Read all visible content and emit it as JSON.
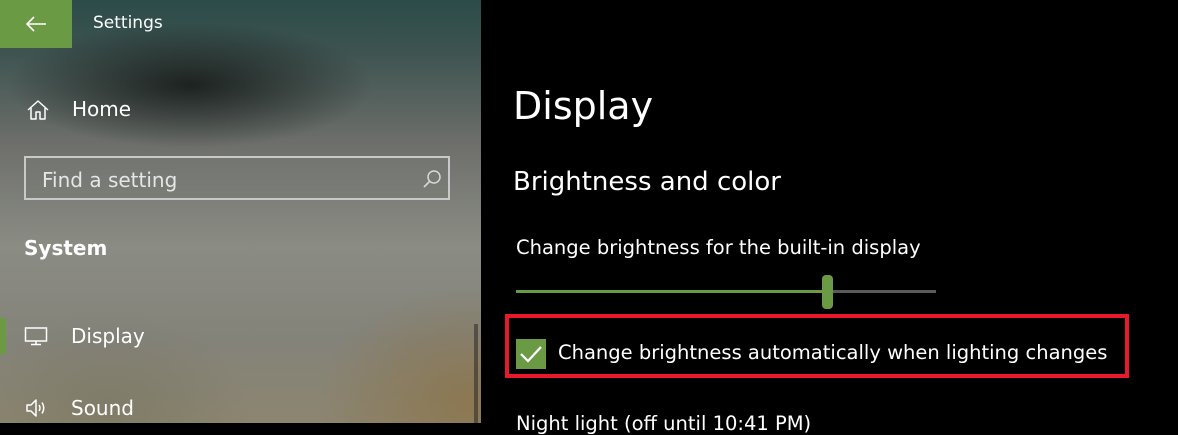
{
  "window": {
    "app_title": "Settings"
  },
  "sidebar": {
    "home_label": "Home",
    "search_placeholder": "Find a setting",
    "section_label": "System",
    "items": [
      {
        "label": "Display",
        "icon": "display-icon",
        "selected": true
      },
      {
        "label": "Sound",
        "icon": "speaker-icon",
        "selected": false
      }
    ]
  },
  "main": {
    "title": "Display",
    "section": "Brightness and color",
    "brightness_label": "Change brightness for the built-in display",
    "brightness_value_percent": 74,
    "auto_brightness_label": "Change brightness automatically when lighting changes",
    "auto_brightness_checked": true,
    "night_light_label": "Night light (off until 10:41 PM)"
  },
  "colors": {
    "accent": "#6b9a45",
    "highlight_border": "#e8192c",
    "main_background": "#000000"
  }
}
